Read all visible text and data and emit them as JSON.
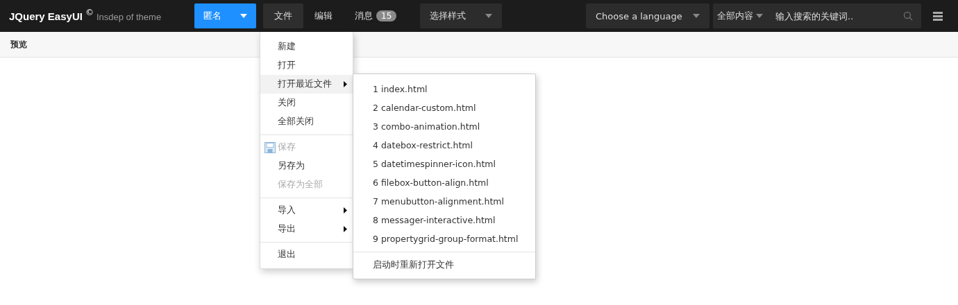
{
  "header": {
    "logo": "JQuery EasyUI",
    "logo_mark": "©",
    "subtitle": "Insdep of theme",
    "user_button": "匿名",
    "nav": [
      {
        "label": "文件",
        "selected": true
      },
      {
        "label": "编辑",
        "selected": false
      },
      {
        "label": "消息",
        "selected": false,
        "badge": "15"
      }
    ],
    "style_select": "选择样式",
    "language_select": "Choose a language",
    "search": {
      "category": "全部内容",
      "placeholder": "输入搜索的关键词.."
    }
  },
  "panel": {
    "title": "预览"
  },
  "menu": [
    {
      "kind": "item",
      "label": "新建",
      "disabled": false,
      "selected": false
    },
    {
      "kind": "item",
      "label": "打开",
      "disabled": false,
      "selected": false
    },
    {
      "kind": "item",
      "label": "打开最近文件",
      "disabled": false,
      "selected": true,
      "submenu": true
    },
    {
      "kind": "item",
      "label": "关闭",
      "disabled": false,
      "selected": false
    },
    {
      "kind": "item",
      "label": "全部关闭",
      "disabled": false,
      "selected": false
    },
    {
      "kind": "separator"
    },
    {
      "kind": "save_item",
      "label": "保存",
      "disabled": true,
      "selected": false
    },
    {
      "kind": "item",
      "label": "另存为",
      "disabled": false,
      "selected": false
    },
    {
      "kind": "item",
      "label": "保存为全部",
      "disabled": true,
      "selected": false
    },
    {
      "kind": "separator"
    },
    {
      "kind": "item",
      "label": "导入",
      "disabled": false,
      "selected": false,
      "submenu": true
    },
    {
      "kind": "item",
      "label": "导出",
      "disabled": false,
      "selected": false,
      "submenu": true
    },
    {
      "kind": "separator"
    },
    {
      "kind": "item",
      "label": "退出",
      "disabled": false,
      "selected": false
    }
  ],
  "submenu": [
    {
      "kind": "item",
      "label": "1 index.html"
    },
    {
      "kind": "item",
      "label": "2 calendar-custom.html"
    },
    {
      "kind": "item",
      "label": "3 combo-animation.html"
    },
    {
      "kind": "item",
      "label": "4 datebox-restrict.html"
    },
    {
      "kind": "item",
      "label": "5 datetimespinner-icon.html"
    },
    {
      "kind": "item",
      "label": "6 filebox-button-align.html"
    },
    {
      "kind": "item",
      "label": "7 menubutton-alignment.html"
    },
    {
      "kind": "item",
      "label": "8 messager-interactive.html"
    },
    {
      "kind": "item",
      "label": "9 propertygrid-group-format.html"
    },
    {
      "kind": "separator"
    },
    {
      "kind": "item",
      "label": "启动时重新打开文件"
    }
  ]
}
